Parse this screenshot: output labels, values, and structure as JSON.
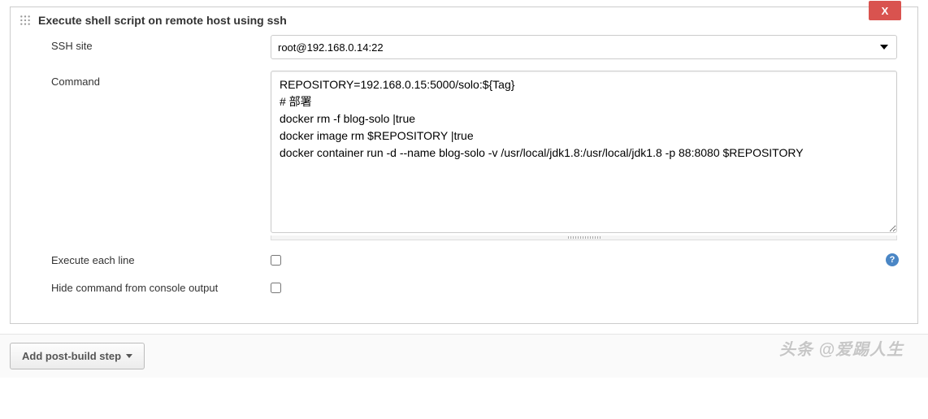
{
  "step": {
    "title": "Execute shell script on remote host using ssh",
    "close_label": "X",
    "fields": {
      "ssh_site": {
        "label": "SSH site",
        "value": "root@192.168.0.14:22"
      },
      "command": {
        "label": "Command",
        "value": "REPOSITORY=192.168.0.15:5000/solo:${Tag}\n# 部署\ndocker rm -f blog-solo |true\ndocker image rm $REPOSITORY |true\ndocker container run -d --name blog-solo -v /usr/local/jdk1.8:/usr/local/jdk1.8 -p 88:8080 $REPOSITORY"
      },
      "execute_each_line": {
        "label": "Execute each line",
        "checked": false
      },
      "hide_command": {
        "label": "Hide command from console output",
        "checked": false
      }
    }
  },
  "help_icon_text": "?",
  "add_step_button": "Add post-build step",
  "watermark": "头条 @爱踢人生"
}
